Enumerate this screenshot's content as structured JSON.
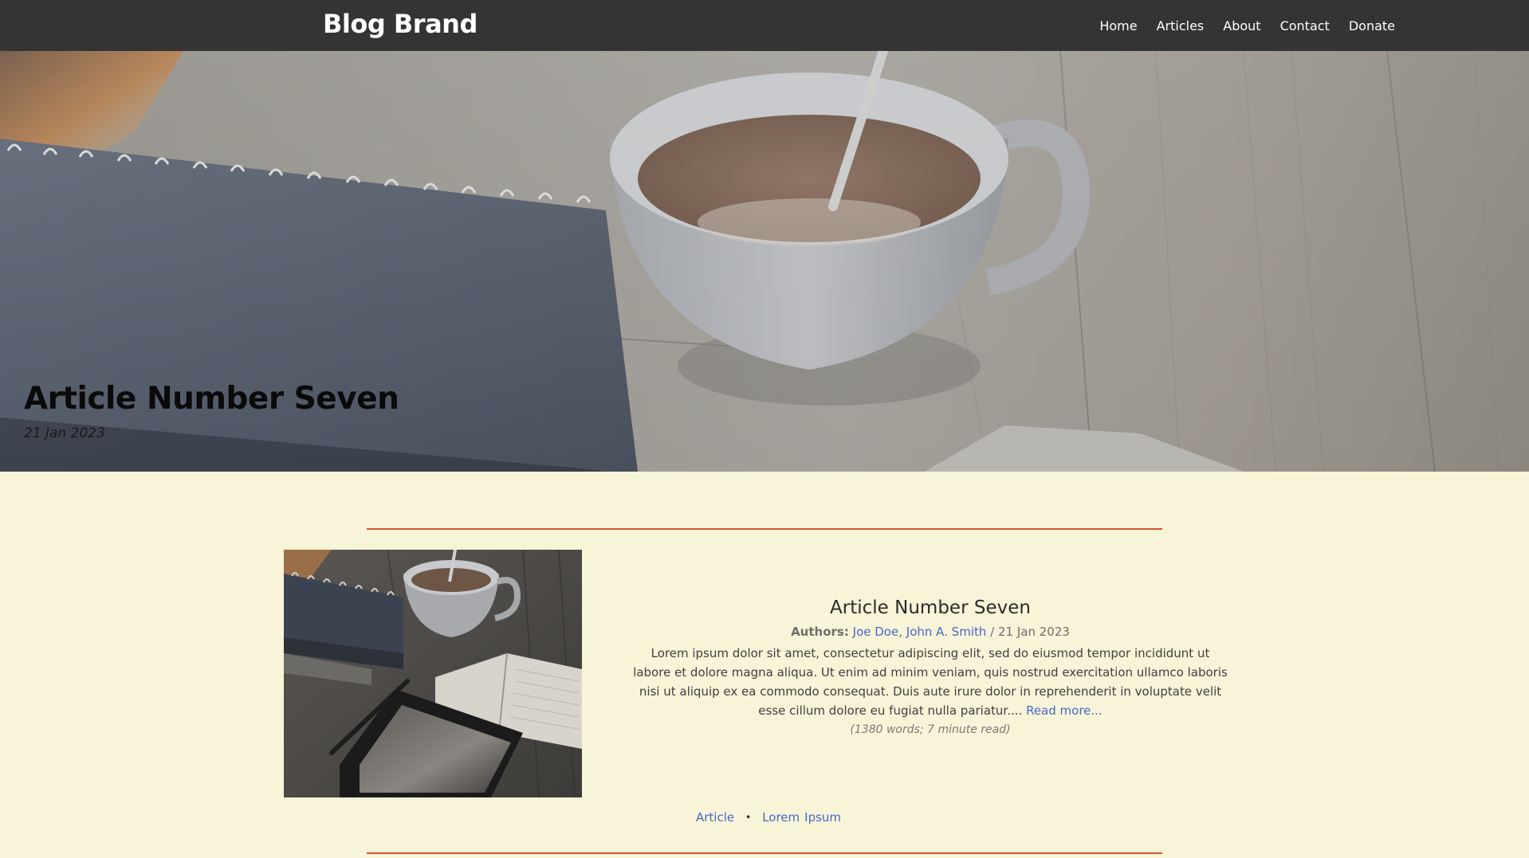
{
  "nav": {
    "brand": "Blog Brand",
    "links": [
      "Home",
      "Articles",
      "About",
      "Contact",
      "Donate"
    ]
  },
  "hero": {
    "title": "Article Number Seven",
    "date": "21 Jan 2023"
  },
  "article": {
    "title": "Article Number Seven",
    "authors_label": "Authors:",
    "authors": [
      "Joe Doe",
      "John A. Smith"
    ],
    "author_separator": ",",
    "date_separator": "/",
    "date": "21 Jan 2023",
    "excerpt": "Lorem ipsum dolor sit amet, consectetur adipiscing elit, sed do eiusmod tempor incididunt ut labore et dolore magna aliqua. Ut enim ad minim veniam, quis nostrud exercitation ullamco laboris nisi ut aliquip ex ea commodo consequat. Duis aute irure dolor in reprehenderit in voluptate velit esse cillum dolore eu fugiat nulla pariatur....",
    "read_more": "Read more...",
    "stats": "(1380 words; 7 minute read)",
    "tag_separator": "•",
    "tags": [
      "Article",
      "Lorem",
      "Ipsum"
    ]
  },
  "colors": {
    "navbar": "#343434",
    "page_background": "#f8f4d8",
    "link": "#4668c9",
    "divider": "#d9532b"
  },
  "icons": {
    "hero_image": "coffee-cup-notebook-photo",
    "thumbnail_image": "coffee-cup-notebook-tablet-photo"
  }
}
